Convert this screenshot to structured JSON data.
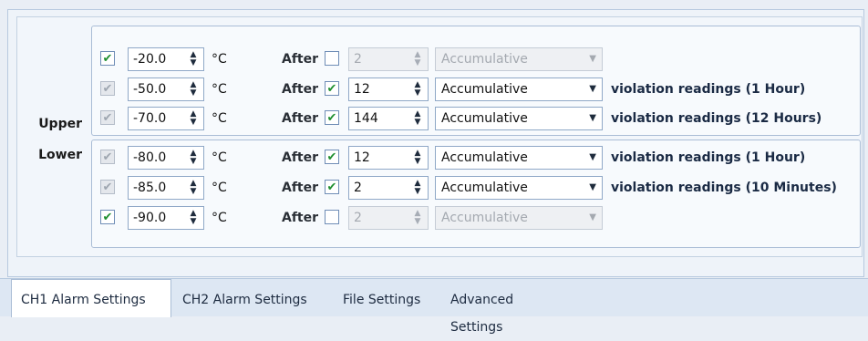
{
  "groups": {
    "upper_label": "Upper",
    "lower_label": "Lower"
  },
  "rows": [
    {
      "enabled": true,
      "enabled_disabled": false,
      "temperature": "-20.0",
      "unit": "°C",
      "after_label": "After",
      "after_checked": false,
      "count": "2",
      "mode": "Accumulative",
      "active": false,
      "suffix": ""
    },
    {
      "enabled": true,
      "enabled_disabled": true,
      "temperature": "-50.0",
      "unit": "°C",
      "after_label": "After",
      "after_checked": true,
      "count": "12",
      "mode": "Accumulative",
      "active": true,
      "suffix": "violation readings (1 Hour)"
    },
    {
      "enabled": true,
      "enabled_disabled": true,
      "temperature": "-70.0",
      "unit": "°C",
      "after_label": "After",
      "after_checked": true,
      "count": "144",
      "mode": "Accumulative",
      "active": true,
      "suffix": "violation readings (12 Hours)"
    },
    {
      "enabled": true,
      "enabled_disabled": true,
      "temperature": "-80.0",
      "unit": "°C",
      "after_label": "After",
      "after_checked": true,
      "count": "12",
      "mode": "Accumulative",
      "active": true,
      "suffix": "violation readings (1 Hour)"
    },
    {
      "enabled": true,
      "enabled_disabled": true,
      "temperature": "-85.0",
      "unit": "°C",
      "after_label": "After",
      "after_checked": true,
      "count": "2",
      "mode": "Accumulative",
      "active": true,
      "suffix": "violation readings (10 Minutes)"
    },
    {
      "enabled": true,
      "enabled_disabled": false,
      "temperature": "-90.0",
      "unit": "°C",
      "after_label": "After",
      "after_checked": false,
      "count": "2",
      "mode": "Accumulative",
      "active": false,
      "suffix": ""
    }
  ],
  "tabs": [
    {
      "label": "CH1 Alarm Settings",
      "active": true
    },
    {
      "label": "CH2 Alarm Settings",
      "active": false
    },
    {
      "label": "File Settings",
      "active": false
    },
    {
      "label": "Advanced Settings",
      "active": false
    }
  ],
  "icons": {
    "check": "✔",
    "spin_up": "▲",
    "spin_down": "▼",
    "dropdown": "▼"
  },
  "colors": {
    "check_green": "#1f8f2f",
    "panel_border": "#aabdd6",
    "tab_bar": "#dde7f3"
  }
}
